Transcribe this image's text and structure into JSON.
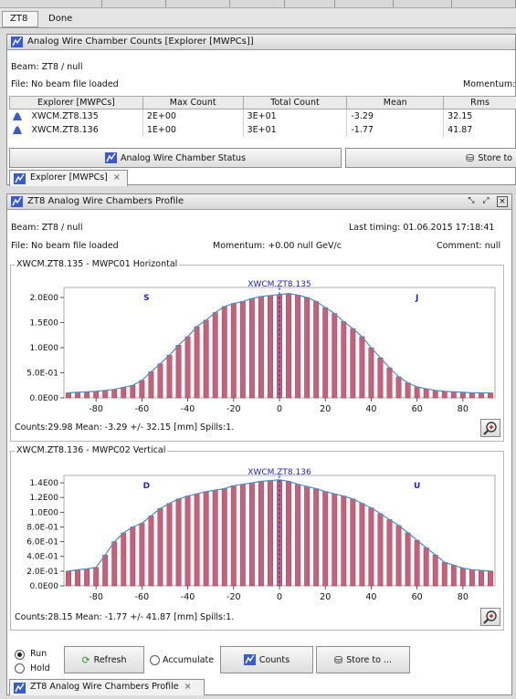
{
  "top_tabs": [
    "ZT8",
    "Done"
  ],
  "counts_panel": {
    "title": "Analog Wire Chamber Counts [Explorer [MWPCs]]",
    "beam": "Beam: ZT8 / null",
    "file": "File: No beam file loaded",
    "momentum": "Momentum:",
    "columns": [
      "Explorer [MWPCs]",
      "Max Count",
      "Total Count",
      "Mean",
      "Rms"
    ],
    "rows": [
      [
        "XWCM.ZT8.135",
        "2E+00",
        "3E+01",
        "-3.29",
        "32.15"
      ],
      [
        "XWCM.ZT8.136",
        "1E+00",
        "3E+01",
        "-1.77",
        "41.87"
      ]
    ],
    "status_button": "Analog Wire Chamber Status",
    "store_button": "Store to",
    "tab_label": "Explorer [MWPCs]",
    "tab_close": "×"
  },
  "profile_panel": {
    "title": "ZT8 Analog Wire Chambers Profile",
    "beam": "Beam: ZT8 / null",
    "last_timing": "Last timing: 01.06.2015 17:18:41",
    "file": "File: No beam file loaded",
    "momentum": "Momentum: +0.00 null GeV/c",
    "comment": "Comment: null",
    "tab_label": "ZT8 Analog Wire Chambers Profile",
    "tab_close": "×"
  },
  "controls": {
    "run": "Run",
    "hold": "Hold",
    "refresh": "Refresh",
    "accumulate": "Accumulate",
    "counts": "Counts",
    "store": "Store to ..."
  },
  "colors": {
    "bar": "#c8607a",
    "curve": "#4a90b8",
    "marker": "#2222dd",
    "label": "#2222cc"
  },
  "chart_data": [
    {
      "type": "bar",
      "group_title": "XWCM.ZT8.135 - MWPC01 Horizontal",
      "title": "XWCM.ZT8.135",
      "footer": "Counts:29.98  Mean: -3.29 +/- 32.15 [mm]  Spills:1.",
      "left_marker": "S",
      "right_marker": "J",
      "xlim": [
        -94,
        94
      ],
      "ylim": [
        0,
        2.2
      ],
      "xticks": [
        -80,
        -60,
        -40,
        -20,
        0,
        20,
        40,
        60,
        80
      ],
      "yticks": [
        0,
        0.5,
        1.0,
        1.5,
        2.0
      ],
      "ytick_labels": [
        "0.0E00",
        "5.0E-01",
        "1.0E00",
        "1.5E00",
        "2.0E00"
      ],
      "mean_line": 0,
      "x": [
        -92,
        -88,
        -84,
        -80,
        -76,
        -72,
        -68,
        -64,
        -60,
        -56,
        -52,
        -48,
        -44,
        -40,
        -36,
        -32,
        -28,
        -24,
        -20,
        -16,
        -12,
        -8,
        -4,
        0,
        4,
        8,
        12,
        16,
        20,
        24,
        28,
        32,
        36,
        40,
        44,
        48,
        52,
        56,
        60,
        64,
        68,
        72,
        76,
        80,
        84,
        88,
        92
      ],
      "values": [
        0.1,
        0.11,
        0.12,
        0.13,
        0.15,
        0.17,
        0.21,
        0.25,
        0.35,
        0.52,
        0.68,
        0.85,
        1.05,
        1.22,
        1.42,
        1.55,
        1.7,
        1.82,
        1.88,
        1.92,
        1.98,
        2.02,
        2.04,
        2.06,
        2.08,
        2.05,
        2.0,
        1.92,
        1.8,
        1.68,
        1.52,
        1.38,
        1.22,
        1.0,
        0.8,
        0.6,
        0.42,
        0.3,
        0.22,
        0.18,
        0.15,
        0.13,
        0.12,
        0.11,
        0.1,
        0.1,
        0.1
      ]
    },
    {
      "type": "bar",
      "group_title": "XWCM.ZT8.136 - MWPC02 Vertical",
      "title": "XWCM.ZT8.136",
      "footer": "Counts:28.15  Mean: -1.77 +/- 41.87 [mm]  Spills:1.",
      "left_marker": "D",
      "right_marker": "U",
      "xlim": [
        -94,
        94
      ],
      "ylim": [
        0,
        1.5
      ],
      "xticks": [
        -80,
        -60,
        -40,
        -20,
        0,
        20,
        40,
        60,
        80
      ],
      "yticks": [
        0,
        0.2,
        0.4,
        0.6,
        0.8,
        1.0,
        1.2,
        1.4
      ],
      "ytick_labels": [
        "0.0E00",
        "2.0E-01",
        "4.0E-01",
        "6.0E-01",
        "8.0E-01",
        "1.0E00",
        "1.2E00",
        "1.4E00"
      ],
      "mean_line": 0,
      "x": [
        -92,
        -88,
        -84,
        -80,
        -76,
        -72,
        -68,
        -64,
        -60,
        -56,
        -52,
        -48,
        -44,
        -40,
        -36,
        -32,
        -28,
        -24,
        -20,
        -16,
        -12,
        -8,
        -4,
        0,
        4,
        8,
        12,
        16,
        20,
        24,
        28,
        32,
        36,
        40,
        44,
        48,
        52,
        56,
        60,
        64,
        68,
        72,
        76,
        80,
        84,
        88,
        92
      ],
      "values": [
        0.2,
        0.22,
        0.23,
        0.25,
        0.42,
        0.6,
        0.72,
        0.8,
        0.85,
        0.95,
        1.05,
        1.12,
        1.18,
        1.22,
        1.25,
        1.28,
        1.3,
        1.32,
        1.36,
        1.38,
        1.4,
        1.42,
        1.43,
        1.44,
        1.42,
        1.38,
        1.35,
        1.32,
        1.28,
        1.25,
        1.22,
        1.18,
        1.12,
        1.06,
        0.98,
        0.9,
        0.82,
        0.72,
        0.62,
        0.52,
        0.42,
        0.32,
        0.28,
        0.24,
        0.22,
        0.21,
        0.2
      ]
    }
  ]
}
